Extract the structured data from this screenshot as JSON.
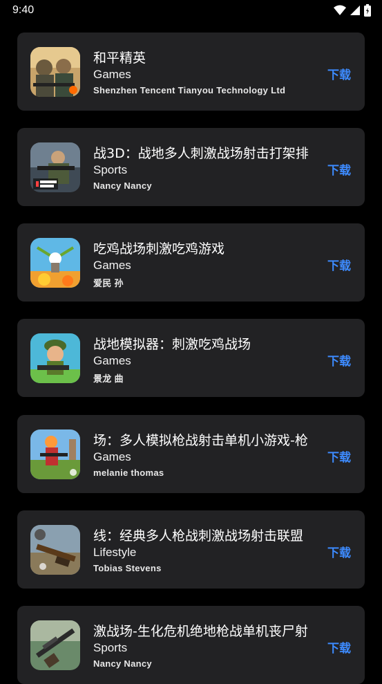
{
  "status_bar": {
    "time": "9:40",
    "icons": [
      "wifi-icon",
      "signal-icon",
      "battery-icon"
    ]
  },
  "apps": [
    {
      "name": "和平精英",
      "category": "Games",
      "developer": "Shenzhen Tencent Tianyou Technology Ltd",
      "download_label": "下载",
      "icon": "pubg-soldier-icon"
    },
    {
      "name": "战3D：战地多人刺激战场射击打架排",
      "category": "Sports",
      "developer": "Nancy Nancy",
      "download_label": "下载",
      "icon": "bullet-fury-icon"
    },
    {
      "name": "吃鸡战场刺激吃鸡游戏",
      "category": "Games",
      "developer": "爱民 孙",
      "download_label": "下载",
      "icon": "parachute-soldier-icon"
    },
    {
      "name": "战地模拟器：刺激吃鸡战场",
      "category": "Games",
      "developer": "景龙 曲",
      "download_label": "下载",
      "icon": "cartoon-soldier-icon"
    },
    {
      "name": "场：多人模拟枪战射击单机小游戏-枪",
      "category": "Games",
      "developer": "melanie thomas",
      "download_label": "下载",
      "icon": "shooter-character-icon"
    },
    {
      "name": "线：经典多人枪战刺激战场射击联盟",
      "category": "Lifestyle",
      "developer": "Tobias Stevens",
      "download_label": "下载",
      "icon": "rifle-battlefield-icon"
    },
    {
      "name": "激战场-生化危机绝地枪战单机丧尸射",
      "category": "Sports",
      "developer": "Nancy Nancy",
      "download_label": "下载",
      "icon": "sniper-rifle-icon"
    }
  ],
  "colors": {
    "background": "#000000",
    "card": "#222224",
    "accent": "#3d8bff"
  }
}
